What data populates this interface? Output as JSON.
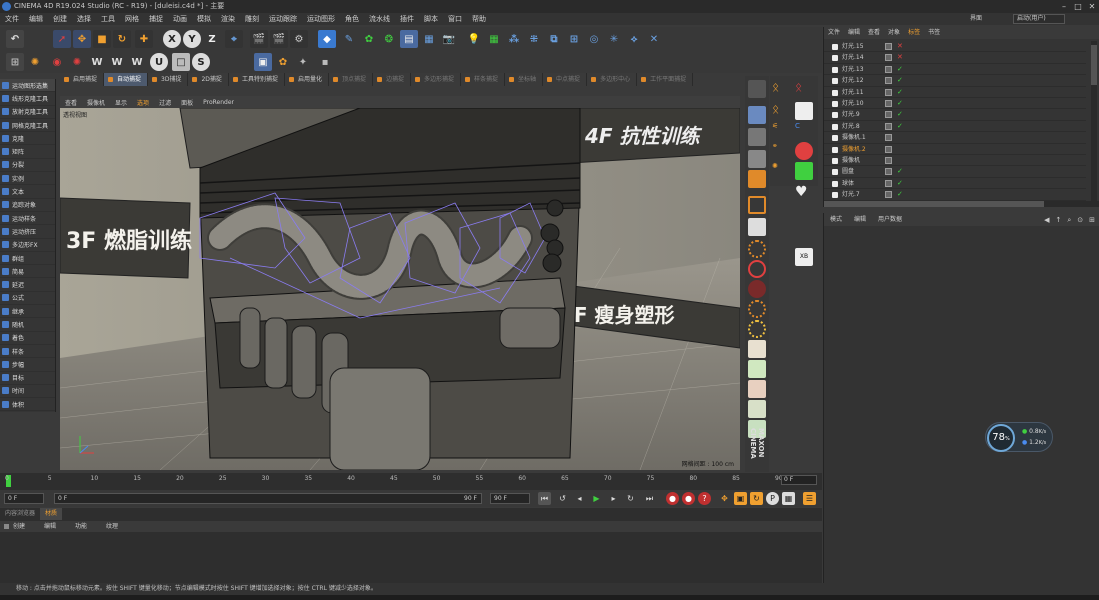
{
  "titlebar": {
    "title": "CINEMA 4D R19.024 Studio (RC - R19) - [duleisi.c4d *] - 主要"
  },
  "menubar": {
    "items": [
      "文件",
      "编辑",
      "创建",
      "选择",
      "工具",
      "网格",
      "捕捉",
      "动画",
      "模拟",
      "渲染",
      "雕刻",
      "运动跟踪",
      "运动图形",
      "角色",
      "流水线",
      "插件",
      "脚本",
      "窗口",
      "帮助"
    ]
  },
  "layout": {
    "label": "界面",
    "value": "启动(用户)"
  },
  "leftpanel": {
    "items": [
      "运动图形选集",
      "线形克隆工具",
      "放射克隆工具",
      "网格克隆工具",
      "克隆",
      "矩阵",
      "分裂",
      "实例",
      "文本",
      "追踪对象",
      "运动样条",
      "运动挤压",
      "多边形FX",
      "群组",
      "简易",
      "延迟",
      "公式",
      "继承",
      "随机",
      "着色",
      "样条",
      "步幅",
      "目标",
      "时间",
      "体积"
    ]
  },
  "modetabs": {
    "items": [
      "启用捕捉",
      "自动捕捉",
      "3D捕捉",
      "2D捕捉",
      "工具特别捕捉",
      "启用量化",
      "顶点捕捉",
      "边捕捉",
      "多边形捕捉",
      "样条捕捉",
      "坐标轴",
      "中点捕捉",
      "多边形中心",
      "工作平面捕捉"
    ]
  },
  "viewport": {
    "menu": [
      "查看",
      "摄像机",
      "显示",
      "选项",
      "过滤",
      "面板",
      "ProRender"
    ],
    "label": "透视视图",
    "grid": "网格间距 : 100 cm",
    "sign_4f": "4F 抗性训练",
    "sign_3f": "3F 燃脂训练",
    "sign_2f": "2F 瘦身塑形"
  },
  "timeline": {
    "ticks": [
      "0",
      "5",
      "10",
      "15",
      "20",
      "25",
      "30",
      "35",
      "40",
      "45",
      "50",
      "55",
      "60",
      "65",
      "70",
      "75",
      "80",
      "85",
      "90"
    ],
    "end_frame": "0 F",
    "start_field": "0 F",
    "range_start": "0 F",
    "range_end": "90 F",
    "max_field": "90 F"
  },
  "material": {
    "tabs": [
      "内容浏览器",
      "材质"
    ],
    "menu": [
      "创建",
      "编辑",
      "功能",
      "纹理"
    ]
  },
  "objects": {
    "menu": [
      "文件",
      "编辑",
      "查看",
      "对象",
      "标签",
      "书签"
    ],
    "items": [
      {
        "name": "灯光.15",
        "status": "✕",
        "color": "#e04040"
      },
      {
        "name": "灯光.14",
        "status": "✕",
        "color": "#e04040"
      },
      {
        "name": "灯光.13",
        "status": "✓",
        "color": "#40d040"
      },
      {
        "name": "灯光.12",
        "status": "✓",
        "color": "#40d040"
      },
      {
        "name": "灯光.11",
        "status": "✓",
        "color": "#40d040"
      },
      {
        "name": "灯光.10",
        "status": "✓",
        "color": "#40d040"
      },
      {
        "name": "灯光.9",
        "status": "✓",
        "color": "#40d040"
      },
      {
        "name": "灯光.8",
        "status": "✓",
        "color": "#40d040"
      },
      {
        "name": "摄像机.1",
        "status": "",
        "color": "#40d040"
      },
      {
        "name": "摄像机.2",
        "status": "",
        "color": "#f0a030"
      },
      {
        "name": "摄像机",
        "status": "",
        "color": "#40d040"
      },
      {
        "name": "圆盘",
        "status": "✓",
        "color": "#40d040"
      },
      {
        "name": "球体",
        "status": "✓",
        "color": "#40d040"
      },
      {
        "name": "灯光.7",
        "status": "✓",
        "color": "#40d040"
      }
    ]
  },
  "attributes": {
    "menu": [
      "模式",
      "编辑",
      "用户数据"
    ]
  },
  "statusbar": {
    "text": "移动 : 点击并拖动鼠标移动元素。按住 SHIFT 键量化移动；节点编辑模式时按住 SHIFT 键增加选择对象；按住 CTRL 键减少选择对象。"
  },
  "network": {
    "percent": "78",
    "unit": "%",
    "up": "0.8",
    "up_unit": "K/s",
    "down": "1.2",
    "down_unit": "K/s"
  },
  "toolbar": {
    "undo": "↶",
    "x": "X",
    "y": "Y",
    "z": "Z"
  }
}
